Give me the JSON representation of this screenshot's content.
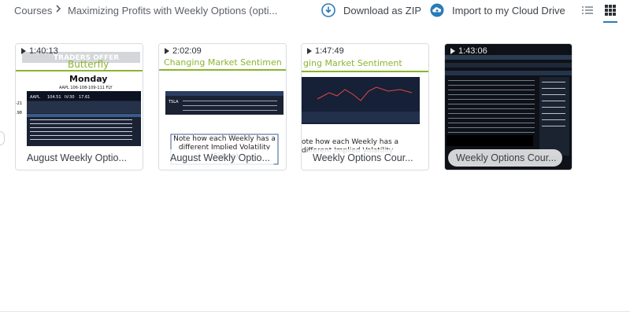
{
  "breadcrumb": {
    "courses": "Courses",
    "current": "Maximizing Profits with Weekly Options (opti..."
  },
  "actions": {
    "download_zip": "Download as ZIP",
    "import_cloud": "Import to my Cloud Drive"
  },
  "colors": {
    "accent": "#2a7bb8",
    "brand_green": "#8ab52f"
  },
  "cards": [
    {
      "duration": "1:40:13",
      "title": "August Weekly Optio...",
      "slide": {
        "watermark": "TRADERS OFFER",
        "heading": "Butterfly",
        "day": "Monday",
        "subtitle": "AAPL 106-108-109-111 FLY",
        "ticker": "AAPL",
        "price": "104.51",
        "iv": "IV:30",
        "iv_val": "17.61",
        "side_a": "-21",
        "side_b": ".98"
      }
    },
    {
      "duration": "2:02:09",
      "title": "August Weekly Optio...",
      "slide": {
        "heading": "Changing Market Sentimen",
        "ticker": "TSLA",
        "note": "Note how each Weekly has a different Implied Volatility (Sigma)"
      }
    },
    {
      "duration": "1:47:49",
      "title": "Weekly Options Cour...",
      "slide": {
        "heading": "ging Market Sentiment",
        "note": "ote how each Weekly has a different Implied Volatility"
      }
    },
    {
      "duration": "1:43:06",
      "title": "Weekly Options Cour..."
    }
  ]
}
